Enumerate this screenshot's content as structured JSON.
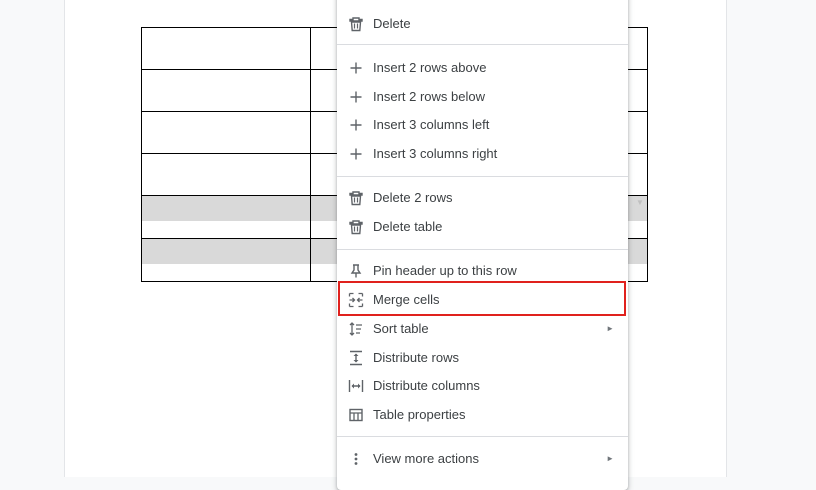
{
  "menu": {
    "items": [
      {
        "label": "Delete",
        "icon": "trash-icon"
      },
      {
        "label": "Insert 2 rows above",
        "icon": "plus-icon"
      },
      {
        "label": "Insert 2 rows below",
        "icon": "plus-icon"
      },
      {
        "label": "Insert 3 columns left",
        "icon": "plus-icon"
      },
      {
        "label": "Insert 3 columns right",
        "icon": "plus-icon"
      },
      {
        "label": "Delete 2 rows",
        "icon": "trash-icon"
      },
      {
        "label": "Delete table",
        "icon": "trash-icon"
      },
      {
        "label": "Pin header up to this row",
        "icon": "pin-icon"
      },
      {
        "label": "Merge cells",
        "icon": "merge-cells-icon"
      },
      {
        "label": "Sort table",
        "icon": "sort-icon",
        "submenu": "►"
      },
      {
        "label": "Distribute rows",
        "icon": "distribute-rows-icon"
      },
      {
        "label": "Distribute columns",
        "icon": "distribute-columns-icon"
      },
      {
        "label": "Table properties",
        "icon": "table-icon"
      },
      {
        "label": "View more actions",
        "icon": "more-vert-icon",
        "submenu": "►"
      }
    ],
    "highlighted_item": "Merge cells"
  },
  "colors": {
    "highlight_border": "#e0211d",
    "selected_row_fill": "#d9d9d9",
    "icon": "#5f6368",
    "text": "#3c4043"
  }
}
